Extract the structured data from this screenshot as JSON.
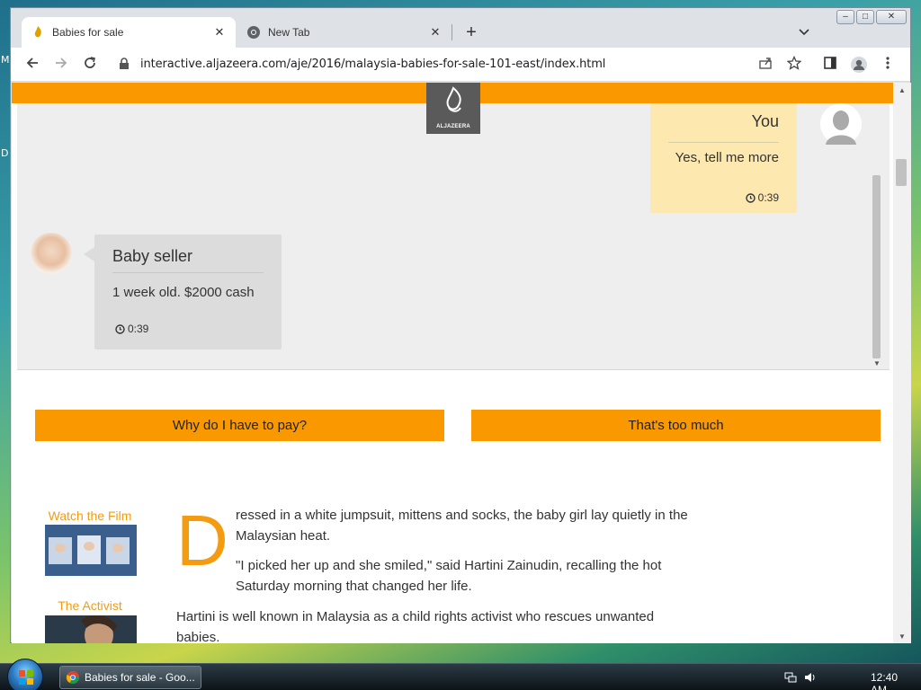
{
  "desktop": {
    "letters": [
      "M",
      "D"
    ]
  },
  "window": {
    "min": "–",
    "max": "□",
    "close": "✕"
  },
  "browser": {
    "tabs": [
      {
        "title": "Babies for sale",
        "close": "✕"
      },
      {
        "title": "New Tab",
        "close": "✕"
      }
    ],
    "new_tab": "+",
    "tab_list": "⌄",
    "url": "interactive.aljazeera.com/aje/2016/malaysia-babies-for-sale-101-east/index.html"
  },
  "page": {
    "logo": {
      "text": "ALJAZEERA",
      "symbol": "الجزيرة"
    },
    "chat": {
      "you": {
        "name": "You",
        "message": "Yes, tell me more",
        "time": "0:39"
      },
      "seller": {
        "name": "Baby seller",
        "message": "1 week old. $2000 cash",
        "time": "0:39"
      }
    },
    "choices": [
      "Why do I have to pay?",
      "That's too much"
    ],
    "sidebar": [
      {
        "label": "Watch the Film"
      },
      {
        "label": "The Activist"
      }
    ],
    "article": {
      "dropcap": "D",
      "p1_line1": "ressed in a white jumpsuit, mittens and socks, the baby girl lay quietly in the",
      "p1_line2": "Malaysian heat.",
      "p2_line1": "\"I picked her up and she smiled,\" said Hartini Zainudin, recalling the hot",
      "p2_line2": "Saturday morning that changed her life.",
      "p3_line1": "Hartini is well known in Malaysia as a child rights activist who rescues unwanted",
      "p3_line2": "babies."
    }
  },
  "taskbar": {
    "task_label": "Babies for sale - Goo...",
    "clock": "12:40 AM"
  }
}
